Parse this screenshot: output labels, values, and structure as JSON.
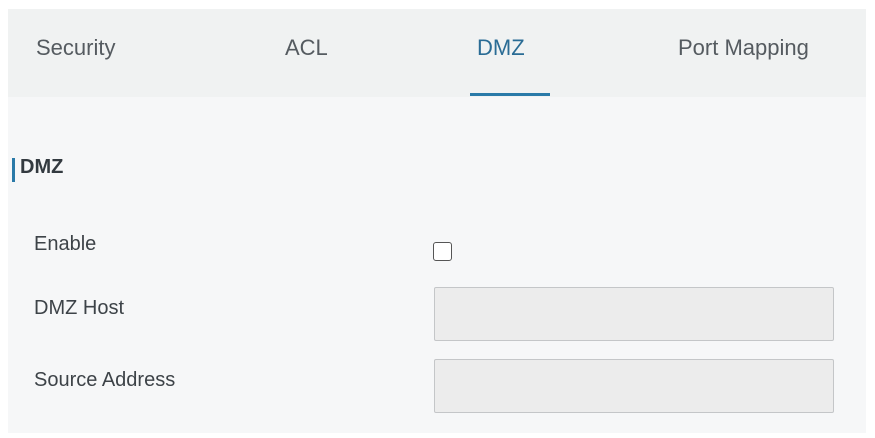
{
  "tabs": [
    {
      "label": "Security",
      "active": false
    },
    {
      "label": "ACL",
      "active": false
    },
    {
      "label": "DMZ",
      "active": true
    },
    {
      "label": "Port Mapping",
      "active": false
    }
  ],
  "section": {
    "title": "DMZ"
  },
  "form": {
    "enable": {
      "label": "Enable",
      "checked": false
    },
    "dmz_host": {
      "label": "DMZ Host",
      "value": ""
    },
    "source_address": {
      "label": "Source Address",
      "value": ""
    }
  },
  "colors": {
    "accent": "#2a7aa8",
    "tab_bar_bg": "#f0f2f2",
    "panel_bg": "#f6f7f8",
    "input_bg": "#ececec"
  }
}
